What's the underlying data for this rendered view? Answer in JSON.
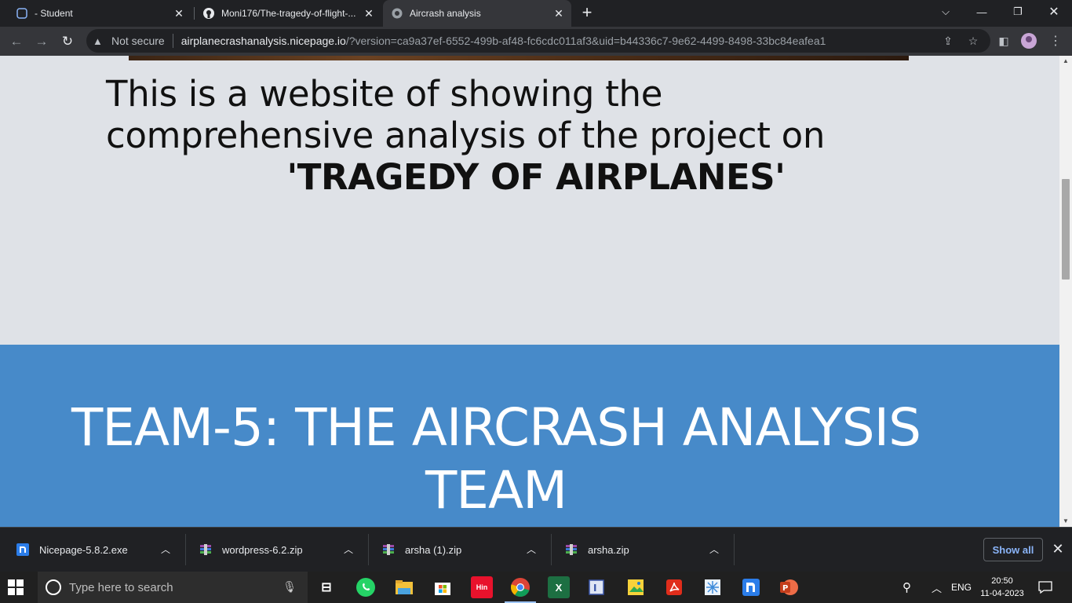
{
  "browser": {
    "tabs": [
      {
        "label": "- Student",
        "icon": "student-page-icon",
        "active": false
      },
      {
        "label": "Moni176/The-tragedy-of-flight-...",
        "icon": "github-icon",
        "active": false
      },
      {
        "label": "Aircrash analysis",
        "icon": "globe-icon",
        "active": true
      }
    ],
    "security_label": "Not secure",
    "url_host": "airplanecrashanalysis.nicepage.io",
    "url_path": "/?version=ca9a37ef-6552-499b-af48-fc6cdc011af3&uid=b44336c7-9e62-4499-8498-33bc84eafea1"
  },
  "page": {
    "intro_text": "This is a website of showing the comprehensive analysis of the project on",
    "intro_bold": "'TRAGEDY OF AIRPLANES'",
    "team_heading": "TEAM-5: THE AIRCRASH ANALYSIS TEAM",
    "section_color": "#478ac9"
  },
  "downloads": {
    "items": [
      {
        "name": "Nicepage-5.8.2.exe",
        "icon": "nicepage-icon"
      },
      {
        "name": "wordpress-6.2.zip",
        "icon": "archive-icon"
      },
      {
        "name": "arsha (1).zip",
        "icon": "archive-icon"
      },
      {
        "name": "arsha.zip",
        "icon": "archive-icon"
      }
    ],
    "show_all_label": "Show all"
  },
  "taskbar": {
    "search_placeholder": "Type here to search",
    "apps": [
      "task-view-icon",
      "whatsapp-icon",
      "file-explorer-icon",
      "microsoft-store-icon",
      "hindi-app-icon",
      "chrome-icon",
      "excel-icon",
      "app-icon",
      "photos-icon",
      "acrobat-icon",
      "snip-icon",
      "nicepage-icon",
      "powerpoint-icon"
    ],
    "hindi_label": "Hin",
    "language": "ENG",
    "time": "20:50",
    "date": "11-04-2023"
  }
}
